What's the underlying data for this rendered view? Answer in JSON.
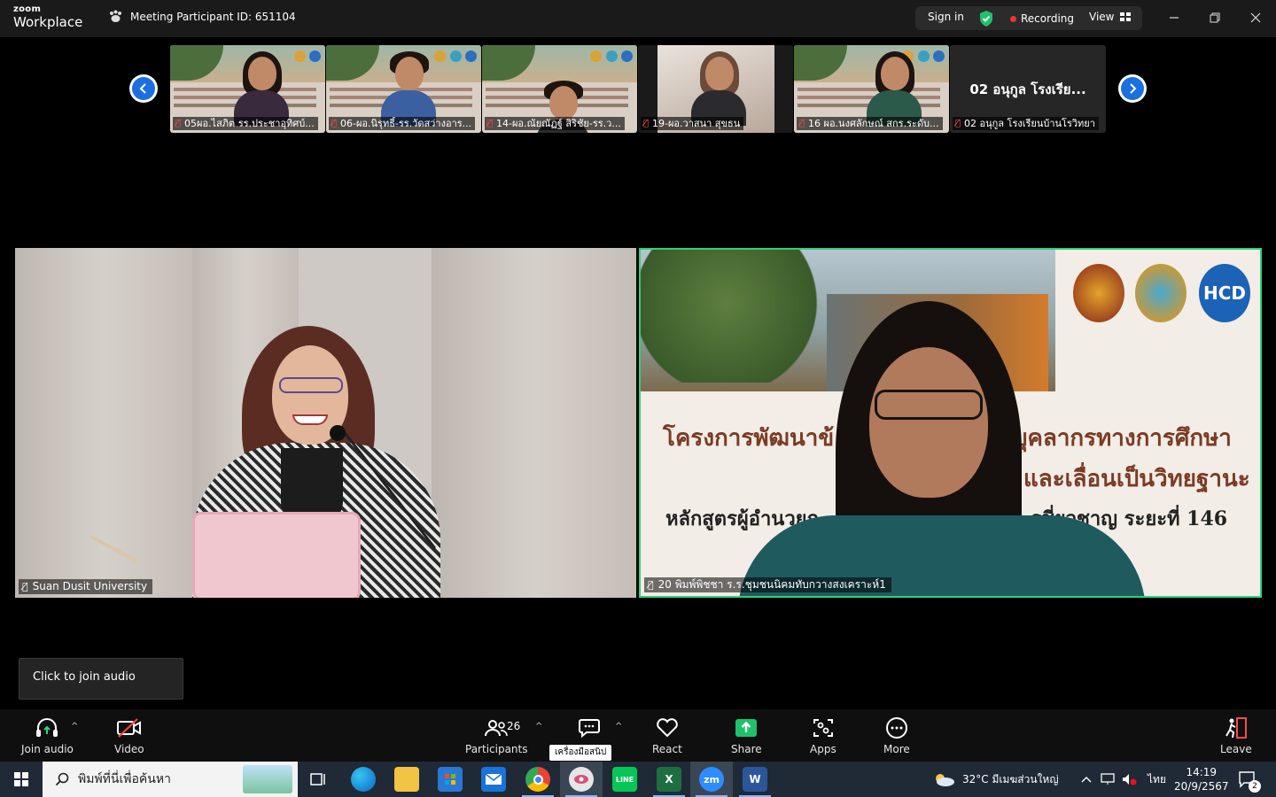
{
  "app": {
    "brand_small": "zoom",
    "brand_large": "Workplace"
  },
  "header": {
    "meeting_id_label": "Meeting Participant ID: 651104",
    "sign_in": "Sign in",
    "recording": "Recording",
    "view": "View"
  },
  "thumbnails": [
    {
      "name": "05ผอ.ไสภิต  รร.ประชาอุทิศบ์...",
      "muted": true
    },
    {
      "name": "06-ผอ.นิรุทธิ์-รร.วัดสว่างอาร...",
      "muted": true
    },
    {
      "name": "14-ผอ.ณัยณัฏฐ์ สิริชัย-รร.ว...",
      "muted": true
    },
    {
      "name": "19-ผอ.วาสนา สุขธน",
      "muted": true
    },
    {
      "name": "16 ผอ.นงศลักษณ์ สกร.ระดับ...",
      "muted": true
    },
    {
      "name": "02 อนุกูล โรงเรียนบ้านโรวิทยา",
      "display_name": "02 อนุกูล โรงเรีย...",
      "muted": true
    }
  ],
  "main_tiles": {
    "left": {
      "name": "Suan Dusit University"
    },
    "right": {
      "name": "20 พิมพ์พิชชา ร.ร.ชุมชนนิคมทับกวางสงเคราะห์1",
      "slide_line1_a": "โครงการพัฒนาข้",
      "slide_line1_b": "บุคลากรทางการศึกษา",
      "slide_line2": "และเลื่อนเป็นวิทยฐานะ",
      "slide_line3_a": "หลักสูตรผู้อำนวยก",
      "slide_line3_b": "รชี่ยวชาญ ระยะที่ 146",
      "logo_text": "HCD"
    }
  },
  "join_audio_tooltip": "Click to join audio",
  "toolbar": {
    "join_audio": "Join audio",
    "video": "Video",
    "participants": "Participants",
    "participants_count": "26",
    "chat_tooltip": "เครื่องมือสนิป",
    "react": "React",
    "share": "Share",
    "apps": "Apps",
    "more": "More",
    "leave": "Leave"
  },
  "taskbar": {
    "search_placeholder": "พิมพ์ที่นี่เพื่อค้นหา",
    "weather": "32°C  มีเมฆส่วนใหญ่",
    "lang": "ไทย",
    "time": "14:19",
    "date": "20/9/2567",
    "notifications": "2"
  },
  "colors": {
    "accent_green": "#2fd17a",
    "nav_blue": "#1b6fe0",
    "record_red": "#e8392c"
  }
}
